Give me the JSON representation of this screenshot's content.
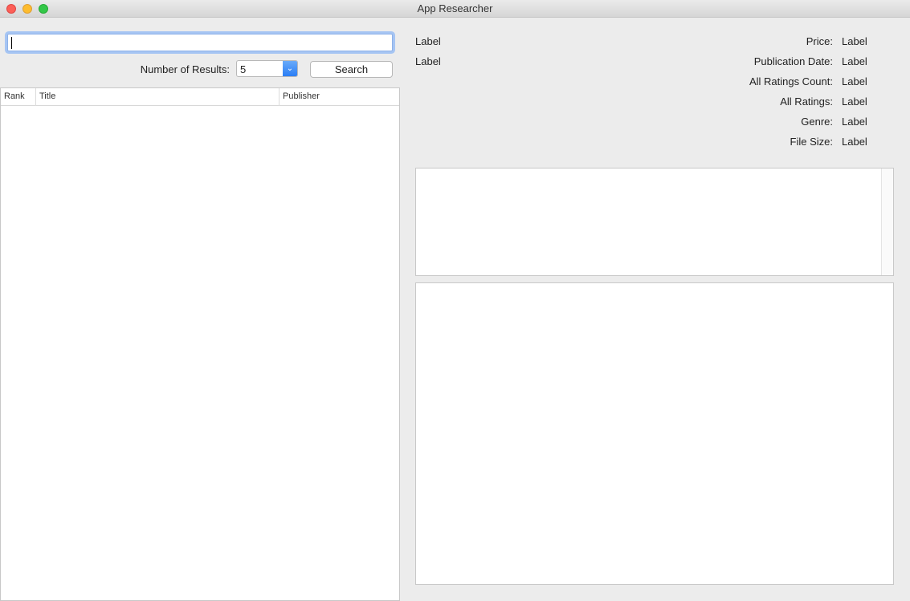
{
  "window": {
    "title": "App Researcher"
  },
  "search": {
    "value": "",
    "results_label": "Number of Results:",
    "results_count": "5",
    "button_label": "Search"
  },
  "table": {
    "columns": [
      "Rank",
      "Title",
      "Publisher"
    ],
    "rows": []
  },
  "details": {
    "left_labels": [
      "Label",
      "Label"
    ],
    "fields": [
      {
        "key": "Price:",
        "value": "Label"
      },
      {
        "key": "Publication Date:",
        "value": "Label"
      },
      {
        "key": "All Ratings Count:",
        "value": "Label"
      },
      {
        "key": "All Ratings:",
        "value": "Label"
      },
      {
        "key": "Genre:",
        "value": "Label"
      },
      {
        "key": "File Size:",
        "value": "Label"
      }
    ]
  },
  "colors": {
    "accent": "#2a7ef5",
    "focus_ring": "#a6c5f3",
    "window_bg": "#ececec"
  }
}
